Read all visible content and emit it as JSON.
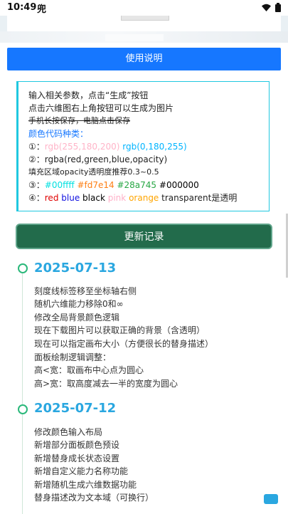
{
  "status_bar": {
    "time": "10:49",
    "app_glyph": "兜"
  },
  "help_button": "使用说明",
  "info": {
    "line1": "输入相关参数，点击“生成”按钮",
    "line2": "点击六维图右上角按钮可以生成为图片",
    "line3": "手机长按保存，电脑点击保存",
    "types_title": "颜色代码种类：",
    "item1_marker": "①：",
    "item1_pink": "rgb(255,180,200)",
    "item1_blue": "rgb(0,180,255)",
    "item2_marker": "②：",
    "item2_text": "rgba(red,green,blue,opacity)",
    "fill_note": "填充区域opacity透明度推荐0.3~0.5",
    "item3_marker": "③：",
    "item3_cyan": "#00ffff",
    "item3_orange": "#fd7e14",
    "item3_green": "#28a745",
    "item3_black": "#000000",
    "item4_marker": "④：",
    "item4_red": "red",
    "item4_blue": "blue",
    "item4_black": "black",
    "item4_pink": "pink",
    "item4_orange": "orange",
    "item4_transparent": "transparent是透明"
  },
  "update_button": "更新记录",
  "changelog": [
    {
      "date": "2025-07-13",
      "items": [
        "刻度线标签移至坐标轴右侧",
        "随机六维能力移除0和∞",
        "修改全局背景颜色逻辑",
        "现在下载图片可以获取正确的背景（含透明）",
        "现在可以指定画布大小（方便很长的替身描述）",
        "面板绘制逻辑调整：",
        "高<宽：取画布中心点为圆心",
        "高>宽：取高度减去一半的宽度为圆心"
      ]
    },
    {
      "date": "2025-07-12",
      "items": [
        "修改颜色输入布局",
        "新增部分面板颜色预设",
        "新增替身成长状态设置",
        "新增自定义能力名称功能",
        "新增随机生成六维数据功能",
        "替身描述改为文本域（可换行）"
      ]
    }
  ],
  "colors": {
    "accent_blue": "#1677ff",
    "update_green": "#226b4b",
    "date_blue": "#2aa7e0",
    "dot_green": "#2ab87a"
  }
}
